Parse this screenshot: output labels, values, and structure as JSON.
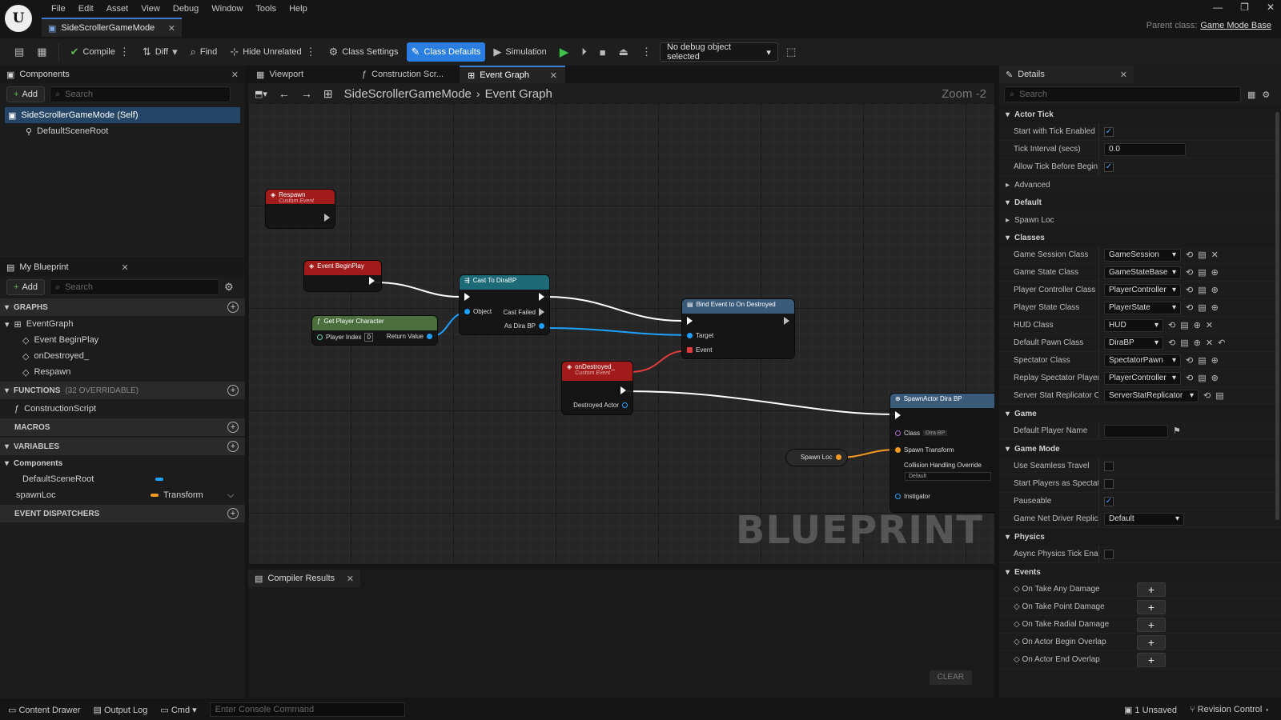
{
  "menu": [
    "File",
    "Edit",
    "Asset",
    "View",
    "Debug",
    "Window",
    "Tools",
    "Help"
  ],
  "doc_tab": "SideScrollerGameMode",
  "parent_class": {
    "label": "Parent class:",
    "value": "Game Mode Base"
  },
  "toolbar": {
    "compile": "Compile",
    "diff": "Diff",
    "find": "Find",
    "hide_unrelated": "Hide Unrelated",
    "class_settings": "Class Settings",
    "class_defaults": "Class Defaults",
    "simulation": "Simulation",
    "debug_object": "No debug object selected"
  },
  "components": {
    "title": "Components",
    "add": "Add",
    "search": "Search",
    "items": [
      "SideScrollerGameMode (Self)",
      "DefaultSceneRoot"
    ]
  },
  "my_blueprint": {
    "title": "My Blueprint",
    "add": "Add",
    "search": "Search",
    "graphs": "GRAPHS",
    "event_graph": "EventGraph",
    "events": [
      "Event BeginPlay",
      "onDestroyed_",
      "Respawn"
    ],
    "functions": "FUNCTIONS",
    "functions_sub": "(32 OVERRIDABLE)",
    "construction": "ConstructionScript",
    "macros": "MACROS",
    "variables": "VARIABLES",
    "var_group": "Components",
    "var_root": "DefaultSceneRoot",
    "var_spawn": "spawnLoc",
    "var_spawn_type": "Transform",
    "dispatchers": "EVENT DISPATCHERS"
  },
  "graph_tabs": [
    "Viewport",
    "Construction Scr...",
    "Event Graph"
  ],
  "breadcrumb": [
    "SideScrollerGameMode",
    "Event Graph"
  ],
  "zoom": "Zoom -2",
  "watermark": "BLUEPRINT",
  "nodes": {
    "respawn": {
      "title": "Respawn",
      "sub": "Custom Event"
    },
    "beginplay": {
      "title": "Event BeginPlay"
    },
    "getplayer": {
      "title": "Get Player Character",
      "pin_in": "Player Index",
      "pin_in_val": "0",
      "pin_out": "Return Value"
    },
    "cast": {
      "title": "Cast To DiraBP",
      "object": "Object",
      "failed": "Cast Failed",
      "as": "As Dira BP"
    },
    "bind": {
      "title": "Bind Event to On Destroyed",
      "target": "Target",
      "event": "Event"
    },
    "ondestroyed": {
      "title": "onDestroyed_",
      "sub": "Custom Event",
      "pin": "Destroyed Actor"
    },
    "spawnloc": {
      "title": "Spawn Loc"
    },
    "spawnactor": {
      "title": "SpawnActor Dira BP",
      "class": "Class",
      "class_val": "Dira BP",
      "transform": "Spawn Transform",
      "collision": "Collision Handling Override",
      "collision_val": "Default",
      "instigator": "Instigator"
    }
  },
  "compiler": {
    "title": "Compiler Results",
    "clear": "CLEAR"
  },
  "details": {
    "title": "Details",
    "search": "Search",
    "actor_tick": "Actor Tick",
    "start_tick": "Start with Tick Enabled",
    "tick_interval": "Tick Interval (secs)",
    "tick_interval_val": "0.0",
    "allow_tick": "Allow Tick Before Begin P...",
    "advanced": "Advanced",
    "default": "Default",
    "spawn_loc": "Spawn Loc",
    "classes": "Classes",
    "class_rows": [
      {
        "label": "Game Session Class",
        "value": "GameSession"
      },
      {
        "label": "Game State Class",
        "value": "GameStateBase"
      },
      {
        "label": "Player Controller Class",
        "value": "PlayerController"
      },
      {
        "label": "Player State Class",
        "value": "PlayerState"
      },
      {
        "label": "HUD Class",
        "value": "HUD"
      },
      {
        "label": "Default Pawn Class",
        "value": "DiraBP"
      },
      {
        "label": "Spectator Class",
        "value": "SpectatorPawn"
      },
      {
        "label": "Replay Spectator Player...",
        "value": "PlayerController"
      },
      {
        "label": "Server Stat Replicator Cla...",
        "value": "ServerStatReplicator"
      }
    ],
    "game": "Game",
    "default_player_name": "Default Player Name",
    "game_mode": "Game Mode",
    "seamless": "Use Seamless Travel",
    "spectators": "Start Players as Spectators",
    "pauseable": "Pauseable",
    "net_driver": "Game Net Driver Replicati...",
    "net_driver_val": "Default",
    "physics": "Physics",
    "async_physics": "Async Physics Tick Enabl...",
    "events": "Events",
    "event_rows": [
      "On Take Any Damage",
      "On Take Point Damage",
      "On Take Radial Damage",
      "On Actor Begin Overlap",
      "On Actor End Overlap"
    ]
  },
  "status": {
    "content_drawer": "Content Drawer",
    "output_log": "Output Log",
    "cmd": "Cmd",
    "console_ph": "Enter Console Command",
    "unsaved": "1 Unsaved",
    "revision": "Revision Control"
  }
}
